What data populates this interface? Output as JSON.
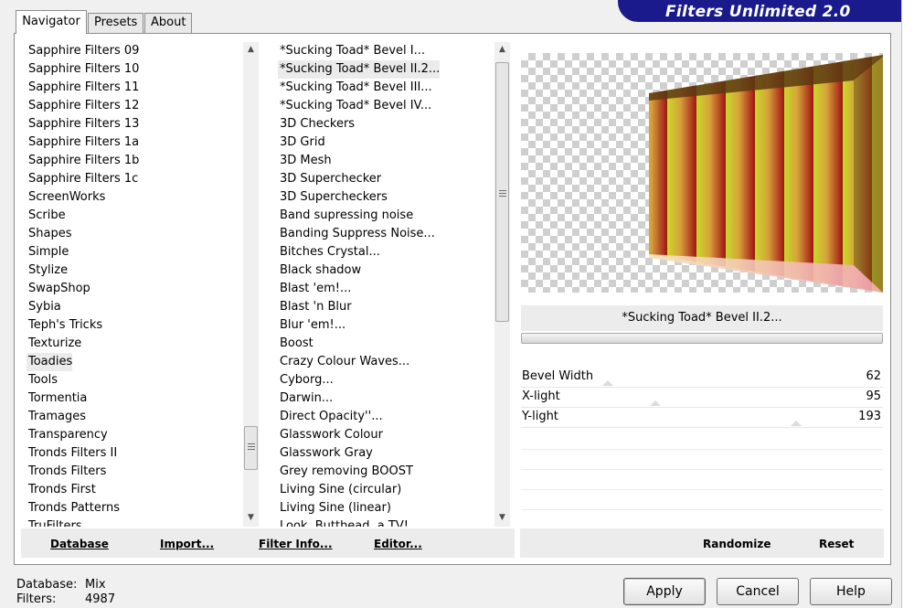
{
  "app": {
    "title": "Filters Unlimited 2.0"
  },
  "tabs": [
    {
      "label": "Navigator",
      "active": true
    },
    {
      "label": "Presets",
      "active": false
    },
    {
      "label": "About",
      "active": false
    }
  ],
  "categories": {
    "items": [
      "Sapphire Filters 09",
      "Sapphire Filters 10",
      "Sapphire Filters 11",
      "Sapphire Filters 12",
      "Sapphire Filters 13",
      "Sapphire Filters 1a",
      "Sapphire Filters 1b",
      "Sapphire Filters 1c",
      "ScreenWorks",
      "Scribe",
      "Shapes",
      "Simple",
      "Stylize",
      "SwapShop",
      "Sybia",
      "Teph's Tricks",
      "Texturize",
      "Toadies",
      "Tools",
      "Tormentia",
      "Tramages",
      "Transparency",
      "Tronds Filters II",
      "Tronds Filters",
      "Tronds First",
      "Tronds Patterns",
      "TruFilters"
    ],
    "selected": "Toadies"
  },
  "filters": {
    "items": [
      "*Sucking Toad* Bevel I...",
      "*Sucking Toad* Bevel II.2...",
      "*Sucking Toad* Bevel III...",
      "*Sucking Toad* Bevel IV...",
      "3D Checkers",
      "3D Grid",
      "3D Mesh",
      "3D Superchecker",
      "3D Supercheckers",
      "Band supressing noise",
      "Banding Suppress Noise...",
      "Bitches Crystal...",
      "Black shadow",
      "Blast 'em!...",
      "Blast 'n Blur",
      "Blur 'em!...",
      "Boost",
      "Crazy Colour Waves...",
      "Cyborg...",
      "Darwin...",
      "Direct Opacity''...",
      "Glasswork Colour",
      "Glasswork Gray",
      "Grey removing BOOST",
      "Living Sine (circular)",
      "Living Sine (linear)",
      "Look, Butthead, a TV!"
    ],
    "selected": "*Sucking Toad* Bevel II.2..."
  },
  "left_buttons": {
    "database": "Database",
    "import": "Import...",
    "filter_info": "Filter Info...",
    "editor": "Editor..."
  },
  "preview": {
    "filter_name": "*Sucking Toad* Bevel II.2..."
  },
  "params": [
    {
      "label": "Bevel Width",
      "value": "62",
      "level": 0.24
    },
    {
      "label": "X-light",
      "value": "95",
      "level": 0.37
    },
    {
      "label": "Y-light",
      "value": "193",
      "level": 0.76
    }
  ],
  "right_buttons": {
    "randomize": "Randomize",
    "reset": "Reset"
  },
  "status": {
    "database_label": "Database:",
    "database_value": "Mix",
    "filters_label": "Filters:",
    "filters_value": "4987"
  },
  "dialog_buttons": {
    "apply": "Apply",
    "cancel": "Cancel",
    "help": "Help"
  },
  "colors": {
    "banner": "#1a1a8c",
    "stripe_red": "#b01a1a",
    "stripe_green": "#c8d62a"
  }
}
